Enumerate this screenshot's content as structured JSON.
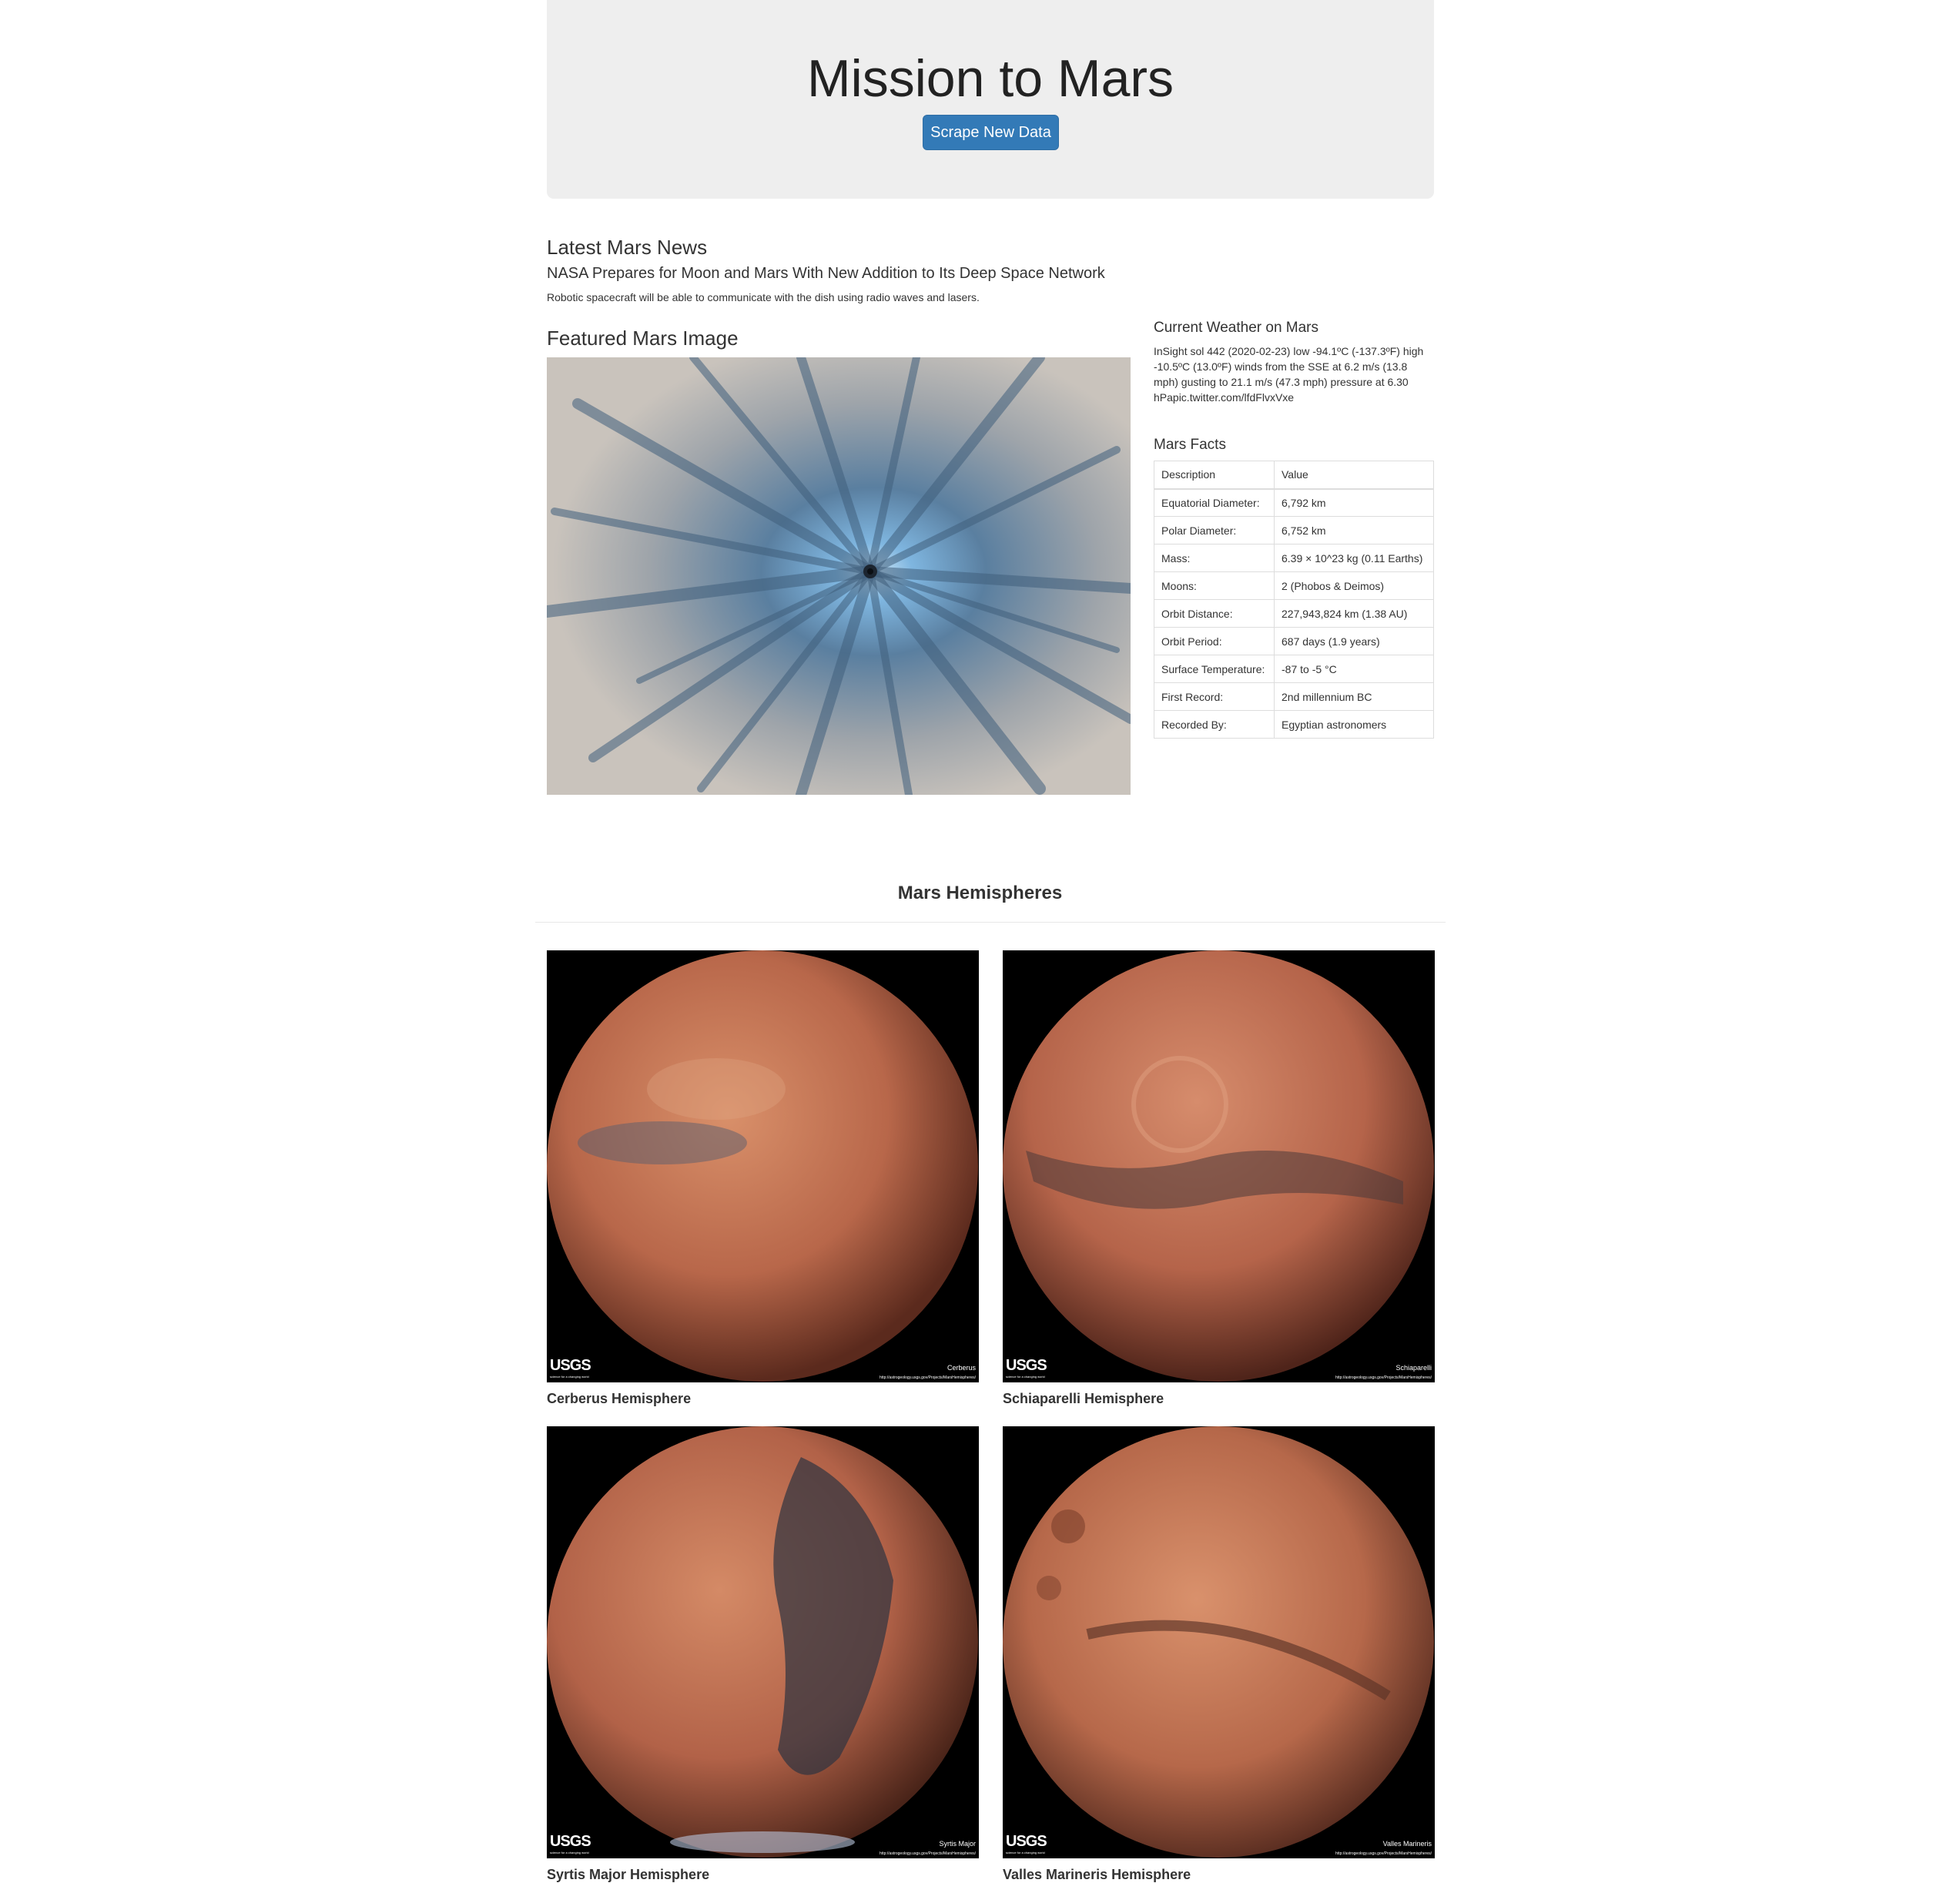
{
  "jumbotron": {
    "title": "Mission to Mars",
    "button_label": "Scrape New Data"
  },
  "news": {
    "header": "Latest Mars News",
    "title": "NASA Prepares for Moon and Mars With New Addition to Its Deep Space Network",
    "teaser": "Robotic spacecraft will be able to communicate with the dish using radio waves and lasers."
  },
  "featured": {
    "header": "Featured Mars Image"
  },
  "weather": {
    "header": "Current Weather on Mars",
    "text": "InSight sol 442 (2020-02-23) low -94.1ºC (-137.3ºF) high -10.5ºC (13.0ºF) winds from the SSE at 6.2 m/s (13.8 mph) gusting to 21.1 m/s (47.3 mph) pressure at 6.30 hPapic.twitter.com/lfdFlvxVxe"
  },
  "facts": {
    "header": "Mars Facts",
    "columns": [
      "Description",
      "Value"
    ],
    "rows": [
      [
        "Equatorial Diameter:",
        "6,792 km"
      ],
      [
        "Polar Diameter:",
        "6,752 km"
      ],
      [
        "Mass:",
        "6.39 × 10^23 kg (0.11 Earths)"
      ],
      [
        "Moons:",
        "2 (Phobos & Deimos)"
      ],
      [
        "Orbit Distance:",
        "227,943,824 km (1.38 AU)"
      ],
      [
        "Orbit Period:",
        "687 days (1.9 years)"
      ],
      [
        "Surface Temperature:",
        "-87 to -5 °C"
      ],
      [
        "First Record:",
        "2nd millennium BC"
      ],
      [
        "Recorded By:",
        "Egyptian astronomers"
      ]
    ]
  },
  "hemispheres": {
    "header": "Mars Hemispheres",
    "logo_text": "USGS",
    "logo_tagline": "science for a changing world",
    "url_text": "http://astrogeology.usgs.gov/Projects/MarsHemispheres/",
    "items": [
      {
        "title": "Cerberus Hemisphere",
        "label": "Cerberus"
      },
      {
        "title": "Schiaparelli Hemisphere",
        "label": "Schiaparelli"
      },
      {
        "title": "Syrtis Major Hemisphere",
        "label": "Syrtis Major"
      },
      {
        "title": "Valles Marineris Hemisphere",
        "label": "Valles Marineris"
      }
    ]
  }
}
